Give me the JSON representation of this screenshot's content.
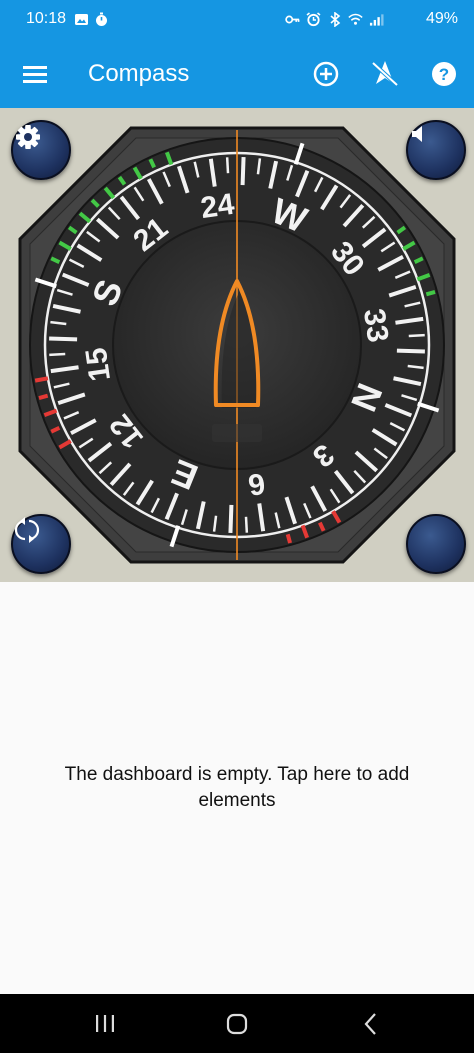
{
  "status_bar": {
    "time": "10:18",
    "battery": "49%",
    "left_icons": [
      "image-icon",
      "stopwatch-icon"
    ],
    "right_icons": [
      "key-icon",
      "alarm-icon",
      "bluetooth-icon",
      "wifi-icon",
      "signal-icon"
    ]
  },
  "app_bar": {
    "title": "Compass",
    "actions": [
      "add-icon",
      "navigation-icon",
      "help-icon"
    ]
  },
  "compass": {
    "heading_labels": [
      "24",
      "W",
      "30",
      "33",
      "N",
      "3",
      "6",
      "E",
      "12",
      "15",
      "S",
      "21"
    ],
    "accent_color": "#f08a24",
    "red_zone_color": "#e53935",
    "green_zone_color": "#43c846"
  },
  "buttons": {
    "settings": "settings-icon",
    "sound": "speaker-icon",
    "rotate": "rotate-icon"
  },
  "dashboard": {
    "empty_message": "The dashboard is empty. Tap here to add elements"
  },
  "nav_bar": {
    "items": [
      "recents-icon",
      "home-icon",
      "back-icon"
    ]
  }
}
